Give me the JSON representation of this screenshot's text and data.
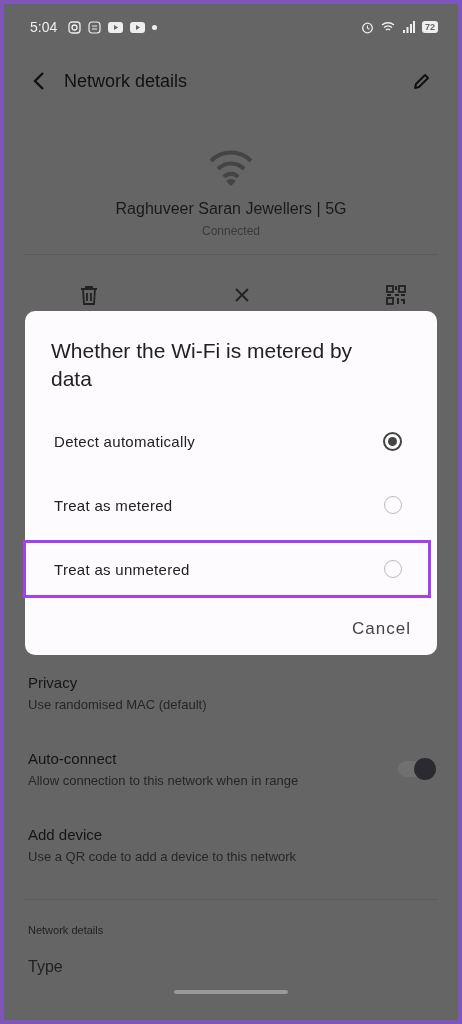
{
  "status_bar": {
    "time": "5:04",
    "battery": "72"
  },
  "header": {
    "title": "Network details"
  },
  "network": {
    "name": "Raghuveer Saran Jewellers | 5G",
    "status": "Connected"
  },
  "dialog": {
    "title": "Whether the Wi-Fi is metered by data",
    "options": [
      {
        "label": "Detect automatically",
        "selected": true,
        "highlighted": false
      },
      {
        "label": "Treat as metered",
        "selected": false,
        "highlighted": false
      },
      {
        "label": "Treat as unmetered",
        "selected": false,
        "highlighted": true
      }
    ],
    "cancel": "Cancel"
  },
  "settings": [
    {
      "kind": "plain",
      "title": "Privacy",
      "subtitle": "Use randomised MAC (default)"
    },
    {
      "kind": "toggle",
      "title": "Auto-connect",
      "subtitle": "Allow connection to this network when in range",
      "on": true
    },
    {
      "kind": "plain",
      "title": "Add device",
      "subtitle": "Use a QR code to add a device to this network"
    }
  ],
  "details": {
    "section_title": "Network details",
    "rows": [
      {
        "label": "Type"
      }
    ]
  }
}
